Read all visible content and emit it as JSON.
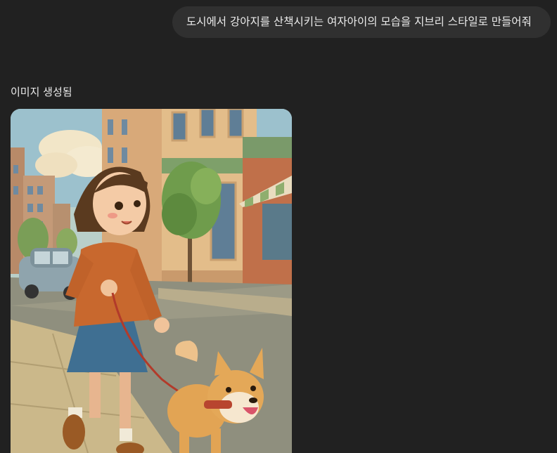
{
  "conversation": {
    "user_message": "도시에서 강아지를 산책시키는 여자아이의 모습을 지브리 스타일로 만들어줘",
    "assistant_status": "이미지 생성됨"
  },
  "image": {
    "subject": "girl-walking-dog-illustration"
  },
  "colors": {
    "background": "#212121",
    "bubble": "#303030",
    "text": "#ececec"
  }
}
